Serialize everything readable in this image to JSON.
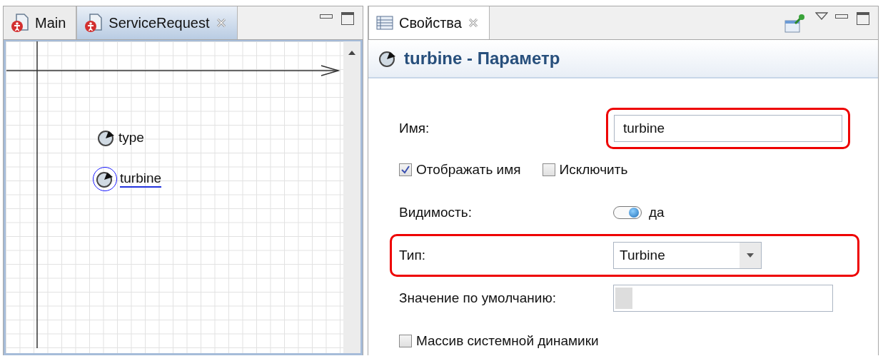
{
  "editor": {
    "tabs": [
      {
        "label": "Main",
        "selected": false,
        "closable": false
      },
      {
        "label": "ServiceRequest",
        "selected": true,
        "closable": true
      }
    ],
    "elements": [
      {
        "label": "type",
        "selected": false
      },
      {
        "label": "turbine",
        "selected": true
      }
    ]
  },
  "properties": {
    "tab": {
      "label": "Свойства",
      "closable": true
    },
    "title": "turbine - Параметр",
    "fields": [
      {
        "kind": "text",
        "label": "Имя:",
        "value": "turbine",
        "highlighted": true
      },
      {
        "kind": "checkboxes",
        "items": [
          {
            "label": "Отображать имя",
            "checked": true
          },
          {
            "label": "Исключить",
            "checked": false
          }
        ]
      },
      {
        "kind": "toggle",
        "label": "Видимость:",
        "on": true,
        "value": "да"
      },
      {
        "kind": "select",
        "label": "Тип:",
        "value": "Turbine",
        "highlighted": true
      },
      {
        "kind": "code",
        "label": "Значение по умолчанию:",
        "highlighted": false
      },
      {
        "kind": "checkbox",
        "label": "Массив системной динамики",
        "checked": false
      }
    ]
  }
}
